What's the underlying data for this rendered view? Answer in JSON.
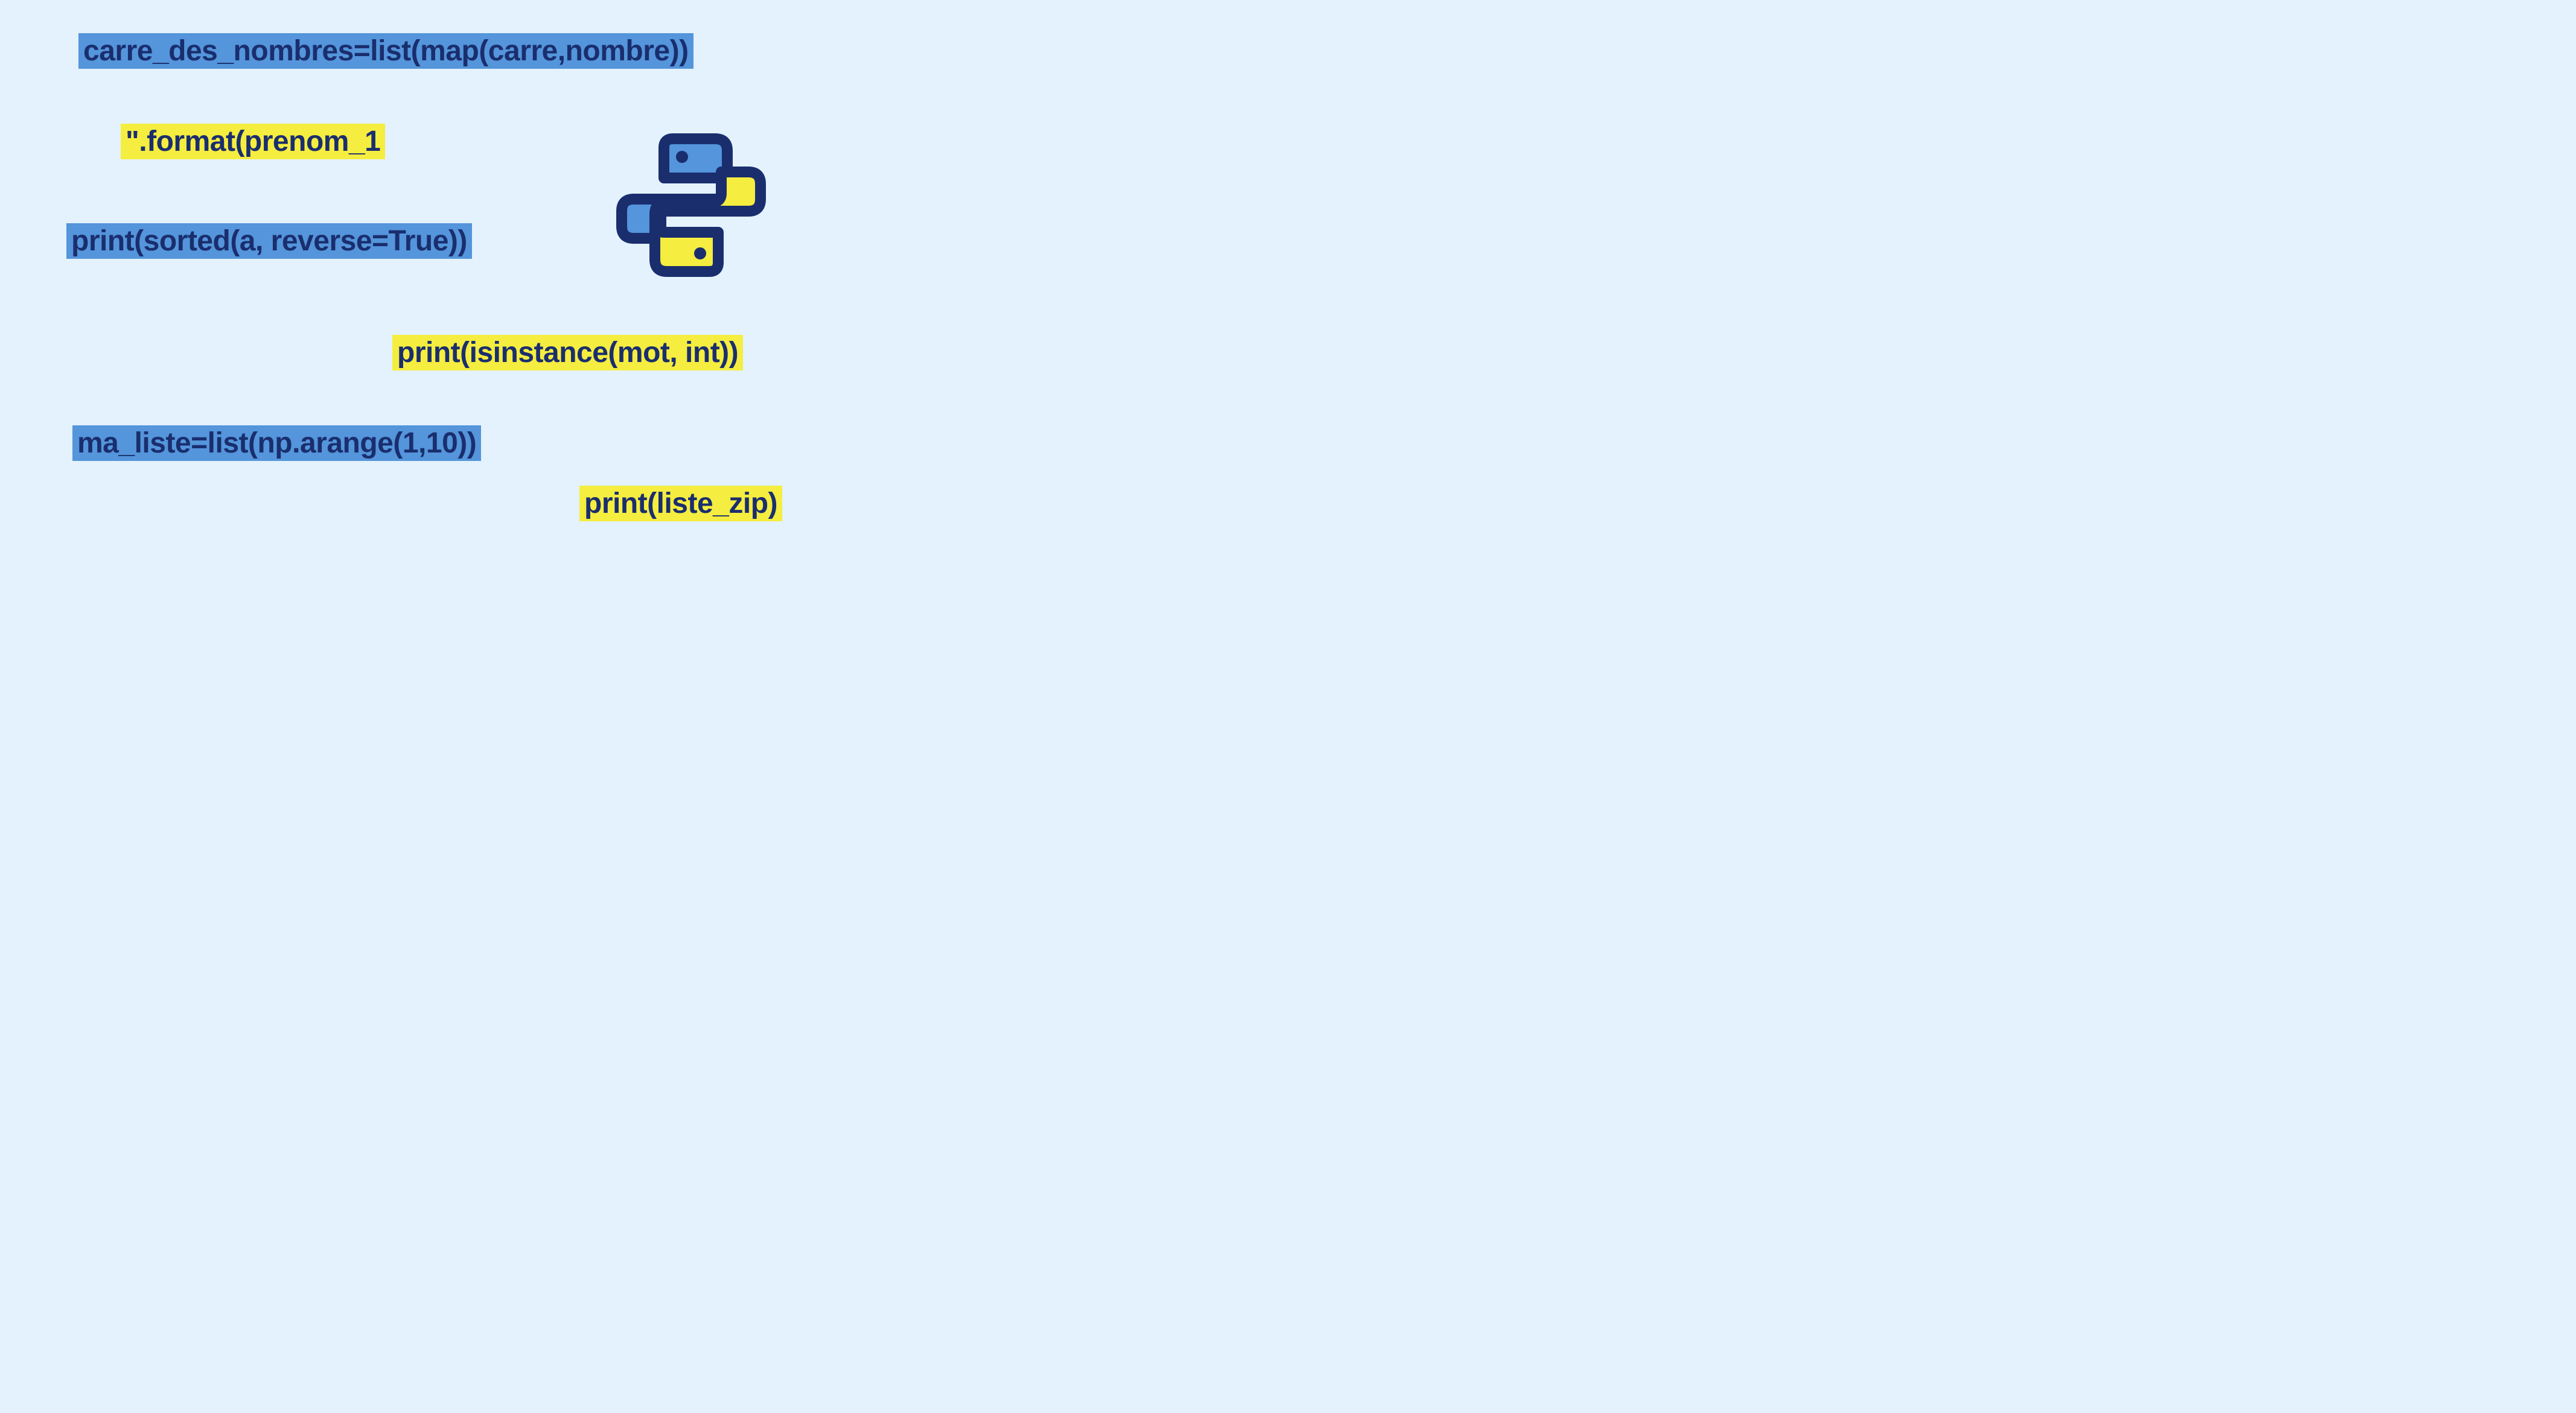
{
  "snippets": {
    "s1": "carre_des_nombres=list(map(carre,nombre))",
    "s2": "\".format(prenom_1",
    "s3": "print(sorted(a, reverse=True))",
    "s4": "print(isinstance(mot, int))",
    "s5": "ma_liste=list(np.arange(1,10))",
    "s6": "print(liste_zip)"
  },
  "logo": {
    "name": "python-logo"
  }
}
